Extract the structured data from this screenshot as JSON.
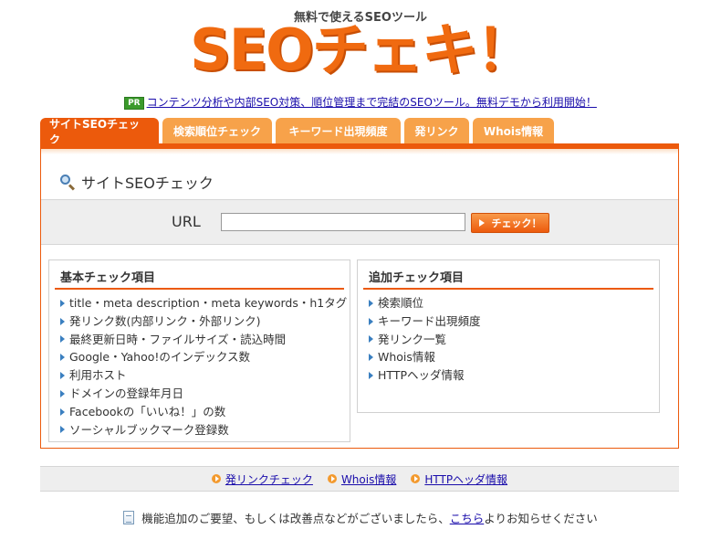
{
  "header": {
    "tagline": "無料で使えるSEOツール",
    "logo_text": "SEOチェキ！",
    "pr_badge": "PR",
    "pr_link": "コンテンツ分析や内部SEO対策、順位管理まで完結のSEOツール。無料デモから利用開始！"
  },
  "tabs": [
    {
      "label": "サイトSEOチェック",
      "active": true
    },
    {
      "label": "検索順位チェック",
      "active": false
    },
    {
      "label": "キーワード出現頻度",
      "active": false
    },
    {
      "label": "発リンク",
      "active": false
    },
    {
      "label": "Whois情報",
      "active": false
    }
  ],
  "panel": {
    "title": "サイトSEOチェック",
    "url_label": "URL",
    "url_value": "",
    "check_button": "チェック！"
  },
  "basic_box": {
    "title": "基本チェック項目",
    "items": [
      "title・meta description・meta keywords・h1タグ",
      "発リンク数(内部リンク・外部リンク)",
      "最終更新日時・ファイルサイズ・読込時間",
      "Google・Yahoo!のインデックス数",
      "利用ホスト",
      "ドメインの登録年月日",
      "Facebookの「いいね！」の数",
      "ソーシャルブックマーク登録数"
    ]
  },
  "extra_box": {
    "title": "追加チェック項目",
    "items": [
      "検索順位",
      "キーワード出現頻度",
      "発リンク一覧",
      "Whois情報",
      "HTTPヘッダ情報"
    ]
  },
  "footer": {
    "links": [
      "発リンクチェック",
      "Whois情報",
      "HTTPヘッダ情報"
    ],
    "notice_before": "機能追加のご要望、もしくは改善点などがございましたら、",
    "notice_link": "こちら",
    "notice_after": "よりお知らせください"
  },
  "colors": {
    "accent": "#ec5a0c",
    "tab_inactive": "#f7a24a",
    "link": "#1a0dab"
  }
}
